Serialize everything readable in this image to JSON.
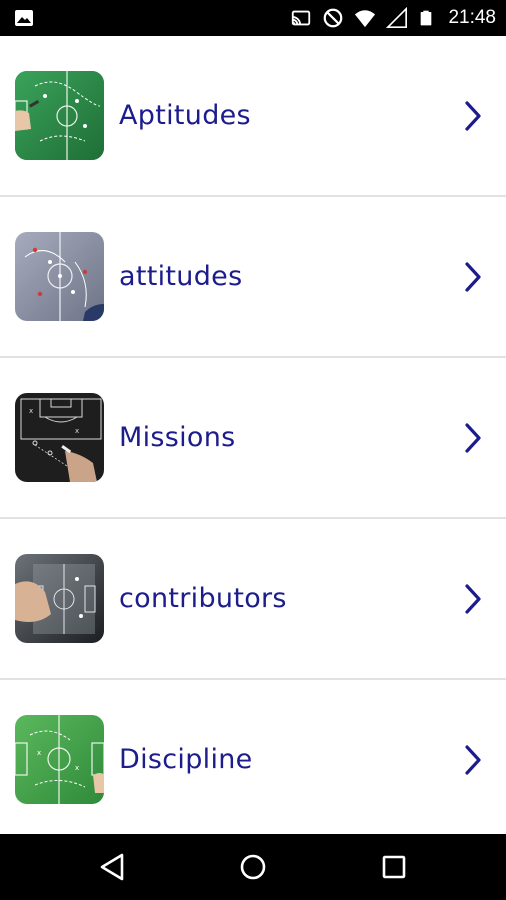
{
  "status_bar": {
    "time": "21:48",
    "icons": [
      "image-notification-icon",
      "cast-icon",
      "do-not-disturb-icon",
      "wifi-icon",
      "signal-icon",
      "battery-icon"
    ]
  },
  "list": {
    "items": [
      {
        "label": "Aptitudes",
        "thumbnail": "green-tactics-board",
        "accent": "#2e8b4a"
      },
      {
        "label": "attitudes",
        "thumbnail": "grey-tactics-board",
        "accent": "#8c93a6"
      },
      {
        "label": "Missions",
        "thumbnail": "chalkboard-tactics",
        "accent": "#1e1e1e"
      },
      {
        "label": "contributors",
        "thumbnail": "glass-tactics-board",
        "accent": "#4a4f55"
      },
      {
        "label": "Discipline",
        "thumbnail": "green-tactics-board-2",
        "accent": "#4aa04a"
      }
    ]
  },
  "nav_bar": {
    "buttons": [
      "back-icon",
      "home-icon",
      "recents-icon"
    ]
  },
  "colors": {
    "label_text": "#1c1c8c",
    "chevron": "#1c1c8c",
    "divider": "#e2e2e2"
  }
}
